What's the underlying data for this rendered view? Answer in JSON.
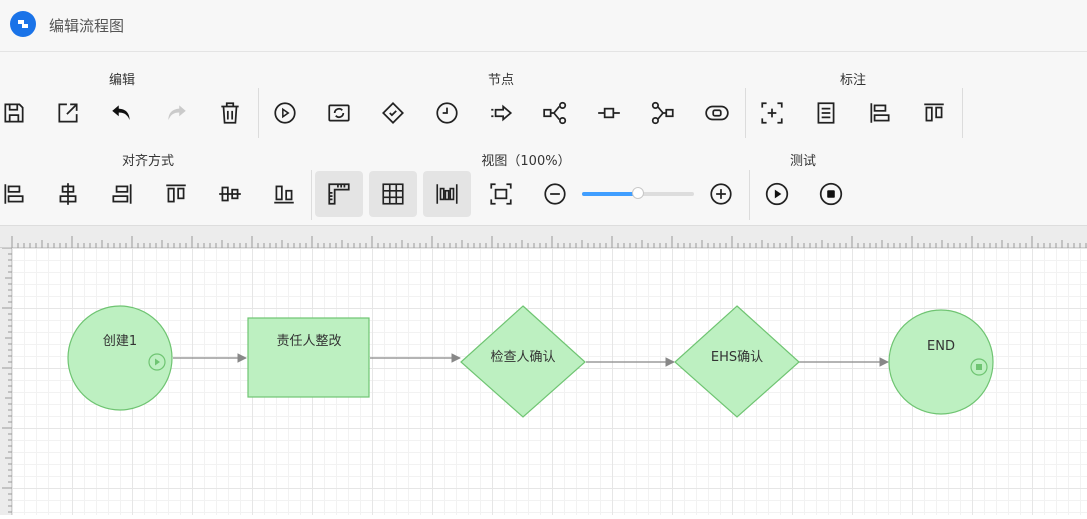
{
  "app": {
    "title": "编辑流程图",
    "logo_icon": "app-logo-icon",
    "brand_color": "#1a73e8"
  },
  "toolbar": {
    "groups": [
      {
        "label": "编辑",
        "buttons": [
          "save-icon",
          "export-icon",
          "undo-icon",
          "redo-icon",
          "delete-icon"
        ]
      },
      {
        "label": "节点",
        "buttons": [
          "start-node-icon",
          "task-node-icon",
          "gateway-node-icon",
          "timer-node-icon",
          "flow-arrow-icon",
          "branch-node-icon",
          "connector-node-icon",
          "merge-node-icon",
          "end-node-icon"
        ]
      },
      {
        "label": "标注",
        "buttons": [
          "add-annotation-icon",
          "note-icon",
          "align-annotation-left-icon",
          "align-annotation-top-icon"
        ]
      },
      {
        "label": "对齐方式",
        "buttons": [
          "align-left-icon",
          "align-center-h-icon",
          "align-right-icon",
          "align-top-icon",
          "align-middle-v-icon",
          "align-bottom-icon"
        ]
      },
      {
        "label": "视图（100%）",
        "buttons": [
          "ruler-toggle-icon",
          "grid-toggle-icon",
          "distribute-icon",
          "fit-screen-icon",
          "zoom-out-icon",
          "zoom-in-icon"
        ]
      },
      {
        "label": "测试",
        "buttons": [
          "run-icon",
          "stop-icon"
        ]
      }
    ],
    "zoom_percent": 100,
    "zoom_slider_fraction": 0.5
  },
  "flow": {
    "node_fill": "#bdf0c1",
    "node_stroke": "#6fc472",
    "edge_color": "#888888",
    "nodes": [
      {
        "id": "create",
        "type": "start",
        "label": "创建1"
      },
      {
        "id": "rectify",
        "type": "task",
        "label": "责任人整改"
      },
      {
        "id": "inspect",
        "type": "gateway",
        "label": "检查人确认"
      },
      {
        "id": "ehs",
        "type": "gateway",
        "label": "EHS确认"
      },
      {
        "id": "end",
        "type": "end",
        "label": "END"
      }
    ],
    "edges": [
      {
        "from": "create",
        "to": "rectify"
      },
      {
        "from": "rectify",
        "to": "inspect"
      },
      {
        "from": "inspect",
        "to": "ehs"
      },
      {
        "from": "ehs",
        "to": "end"
      }
    ]
  }
}
